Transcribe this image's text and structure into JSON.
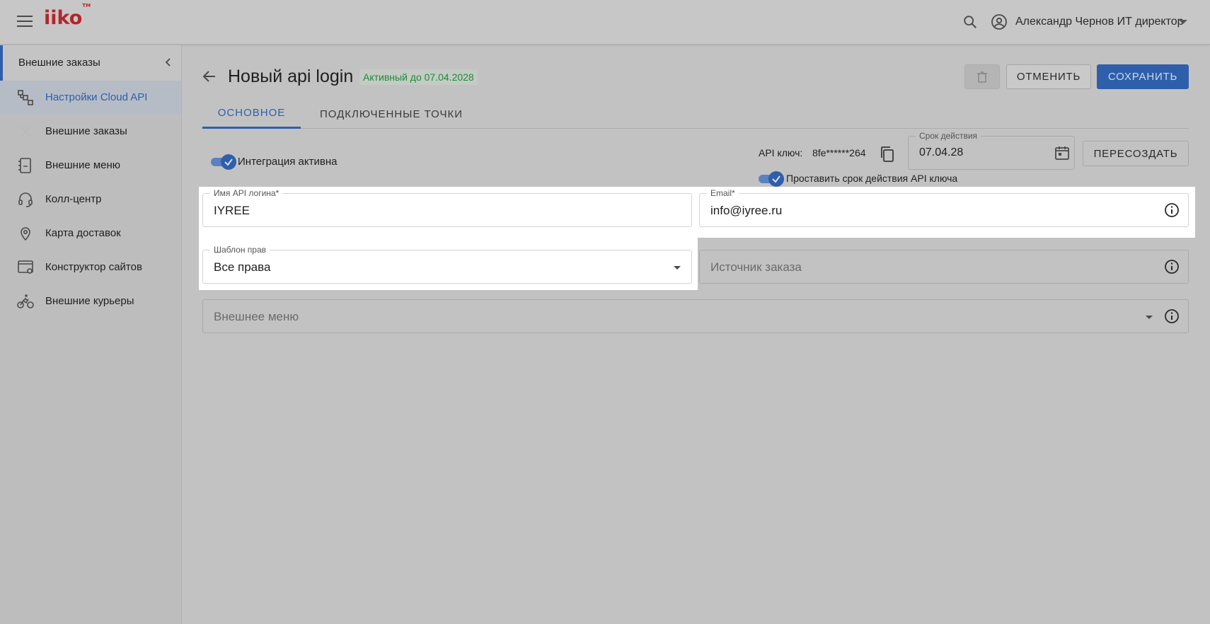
{
  "header": {
    "logo_text": "iiko",
    "logo_tm": "TM",
    "user_name": "Александр Чернов ИТ директор"
  },
  "sidebar": {
    "section_title": "Внешние заказы",
    "items": [
      {
        "label": "Настройки Cloud API",
        "icon": "cloud-api-settings-icon",
        "active": true
      },
      {
        "label": "Внешние заказы",
        "icon": "external-orders-icon",
        "active": false
      },
      {
        "label": "Внешние меню",
        "icon": "external-menu-icon",
        "active": false
      },
      {
        "label": "Колл-центр",
        "icon": "headset-icon",
        "active": false
      },
      {
        "label": "Карта доставок",
        "icon": "map-pin-icon",
        "active": false
      },
      {
        "label": "Конструктор сайтов",
        "icon": "site-builder-icon",
        "active": false
      },
      {
        "label": "Внешние курьеры",
        "icon": "bicycle-courier-icon",
        "active": false
      }
    ]
  },
  "page": {
    "title": "Новый api login",
    "status": "Активный до 07.04.2028"
  },
  "actions": {
    "cancel_label": "Отменить",
    "save_label": "Сохранить"
  },
  "tabs": [
    {
      "label": "Основное",
      "active": true
    },
    {
      "label": "Подключенные точки",
      "active": false
    }
  ],
  "integration": {
    "toggle_label": "Интеграция активна",
    "enabled": true
  },
  "api_key": {
    "label": "API ключ:",
    "value": "8fe******264",
    "expire_label": "Срок действия",
    "expire_value": "07.04.28",
    "regenerate_label": "Пересоздать",
    "set_expiry_label": "Проставить срок действия API ключа",
    "set_expiry_enabled": true
  },
  "form": {
    "login_label": "Имя API логина*",
    "login_value": "IYREE",
    "email_label": "Email*",
    "email_value": "info@iyree.ru",
    "rights_label": "Шаблон прав",
    "rights_value": "Все права",
    "source_placeholder": "Источник заказа",
    "menu_placeholder": "Внешнее меню"
  },
  "colors": {
    "accent": "#2f5faa",
    "status_green": "#1f8a3a",
    "brand_red": "#b3262c"
  }
}
